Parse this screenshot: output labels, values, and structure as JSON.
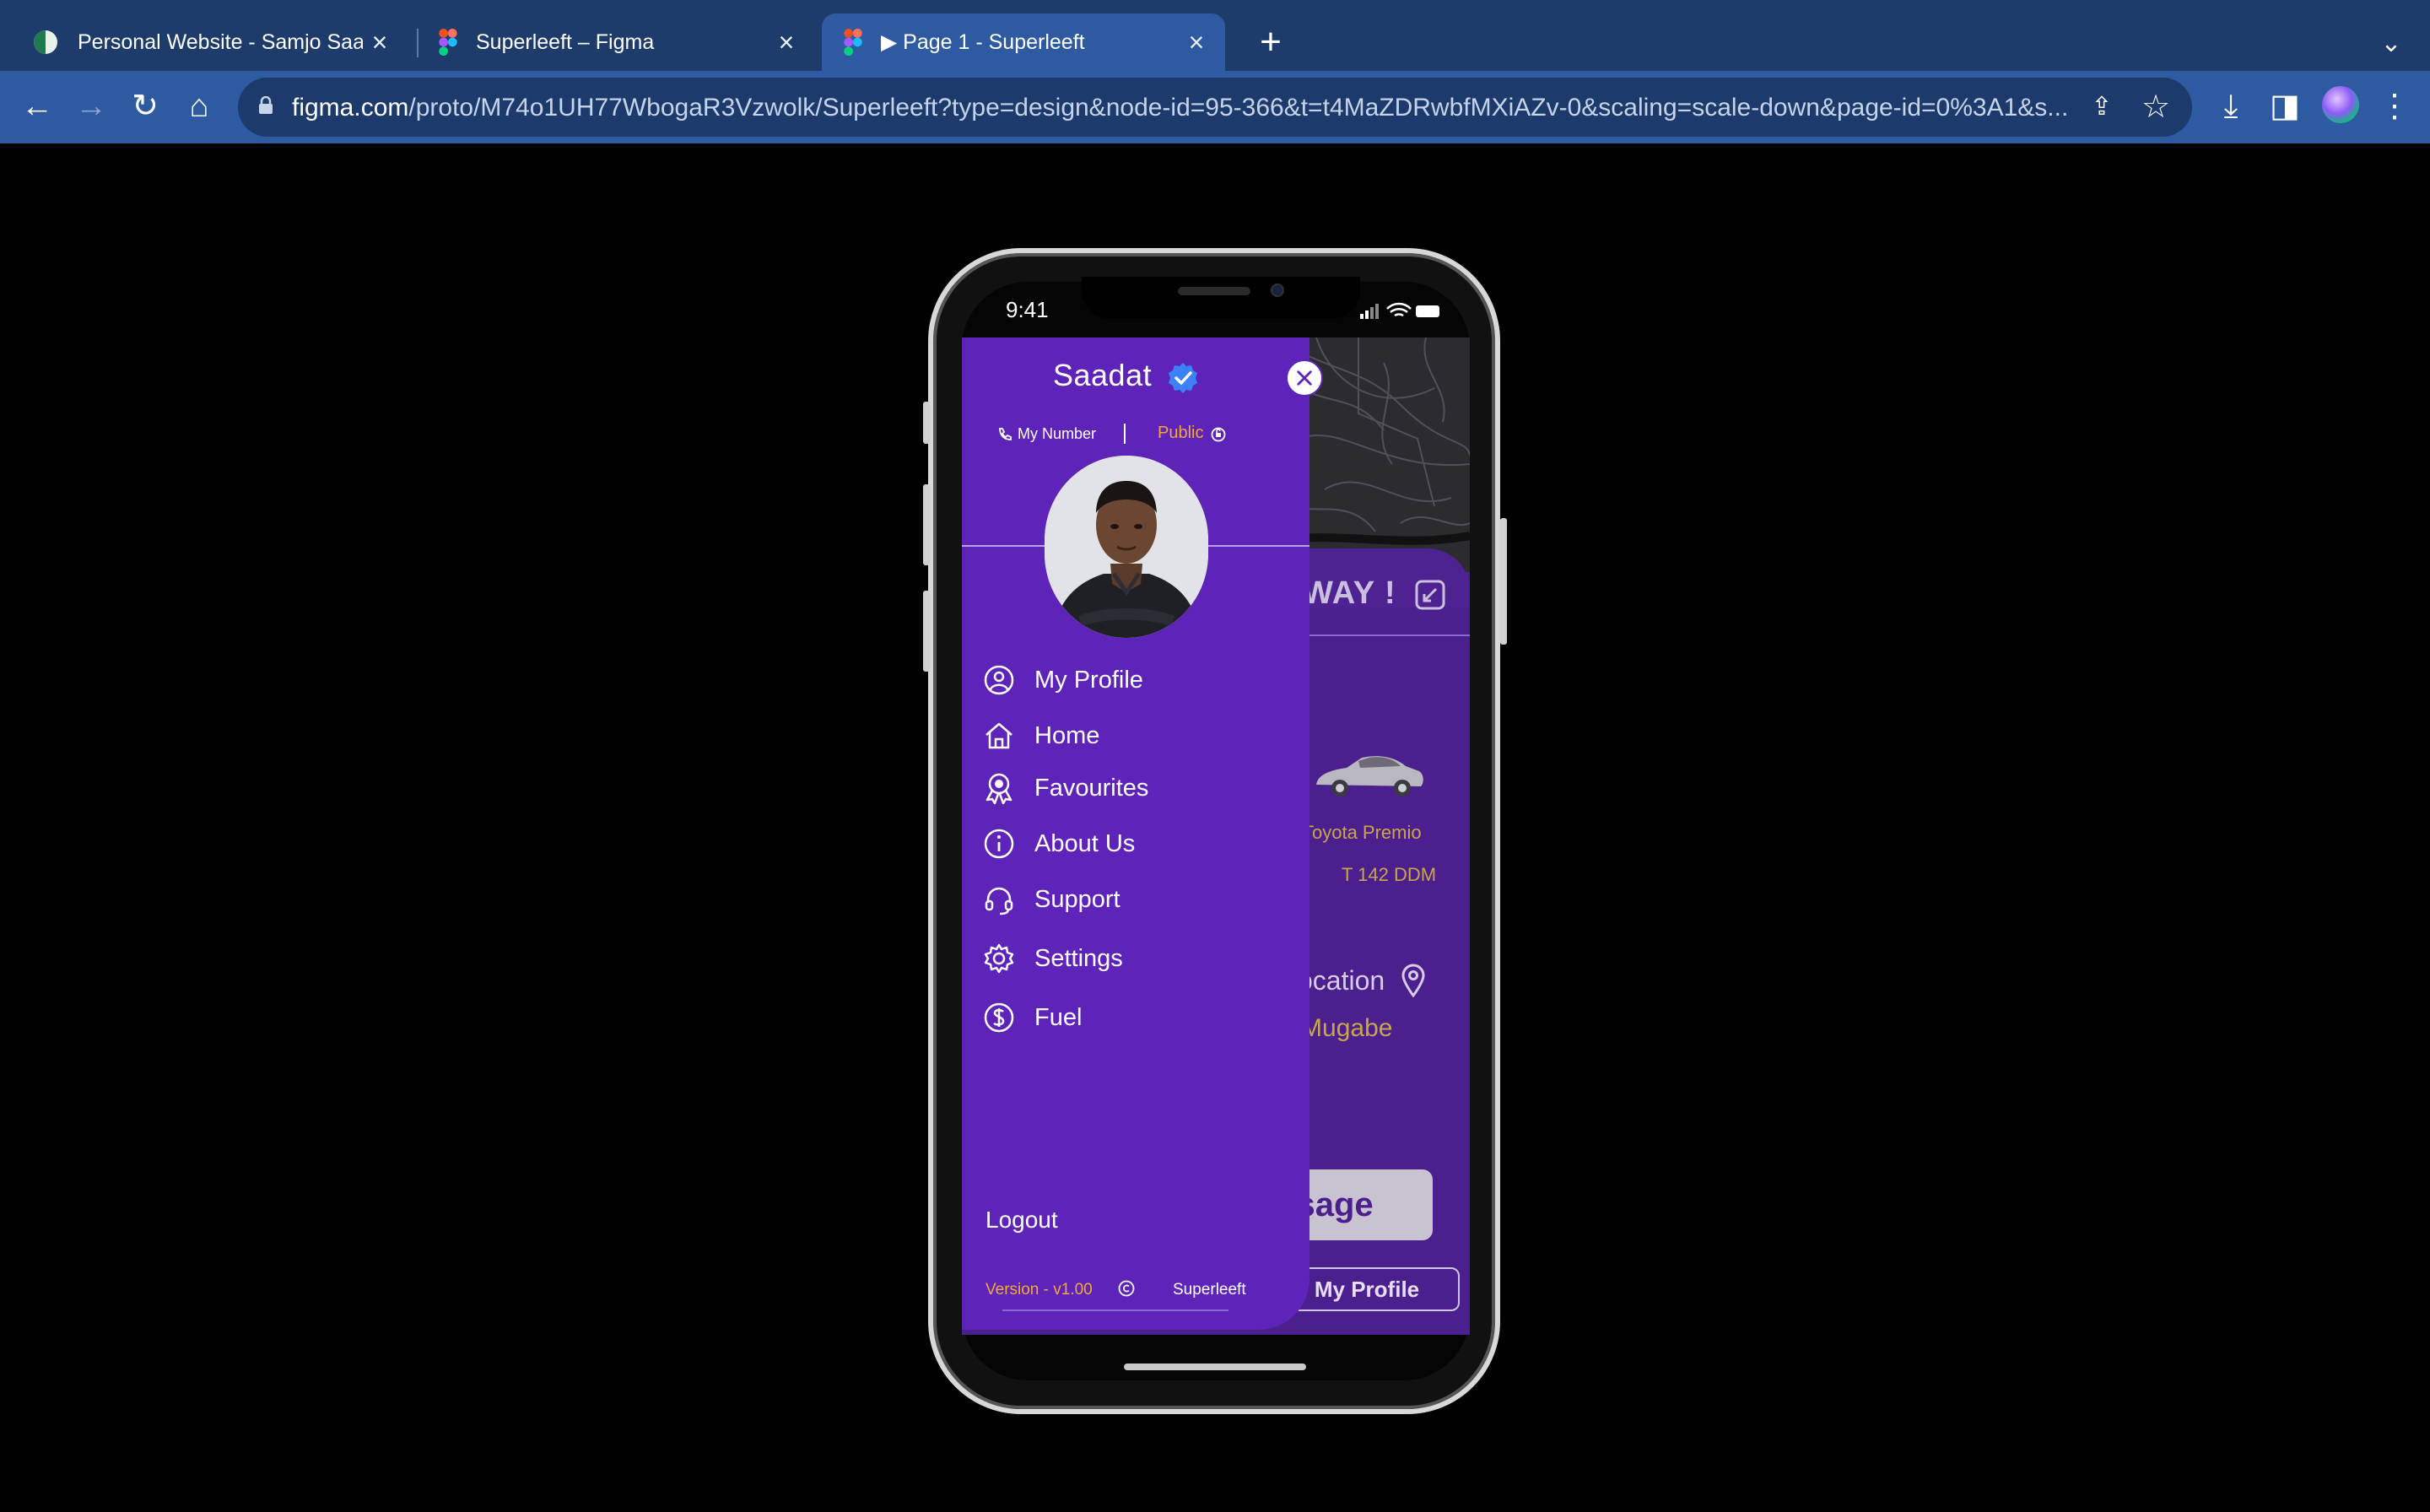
{
  "browser": {
    "tabs": [
      {
        "title": "Personal Website - Samjo Saad",
        "active": false
      },
      {
        "title": "Superleeft – Figma",
        "active": false
      },
      {
        "title": "▶ Page 1 - Superleeft",
        "active": true
      }
    ],
    "url_host": "figma.com",
    "url_path": "/proto/M74o1UH77WbogaR3Vzwolk/Superleeft?type=design&node-id=95-366&t=t4MaZDRwbfMXiAZv-0&scaling=scale-down&page-id=0%3A1&s...",
    "icons": [
      "back-icon",
      "forward-icon",
      "reload-icon",
      "home-icon",
      "lock-icon",
      "share-icon",
      "star-icon",
      "download-icon",
      "sidebar-icon",
      "profile-avatar",
      "menu-icon"
    ]
  },
  "phone": {
    "status_time": "9:41"
  },
  "background_screen": {
    "heading": "WAY !",
    "car_name": "Toyota Premio",
    "car_plate": "T 142 DDM",
    "location_label": "ocation",
    "location_value": "za Mugabe",
    "message_button": "essage",
    "profile_button": "My Profile"
  },
  "drawer": {
    "name": "Saadat",
    "my_number": "My Number",
    "visibility": "Public",
    "menu": [
      {
        "label": "My Profile",
        "icon": "user-circle-icon"
      },
      {
        "label": "Home",
        "icon": "home-icon"
      },
      {
        "label": "Favourites",
        "icon": "award-icon"
      },
      {
        "label": "About Us",
        "icon": "info-icon"
      },
      {
        "label": "Support",
        "icon": "headset-icon"
      },
      {
        "label": "Settings",
        "icon": "gear-icon"
      },
      {
        "label": "Fuel",
        "icon": "dollar-icon"
      }
    ],
    "logout": "Logout",
    "version": "Version - v1.00",
    "brand": "Superleeft"
  },
  "colors": {
    "chrome_dark": "#1d3b6b",
    "chrome_light": "#2d5aa0",
    "drawer_purple": "#5e23b8",
    "accent_orange": "#f2a93b",
    "app_purple": "#4b1f8e"
  }
}
